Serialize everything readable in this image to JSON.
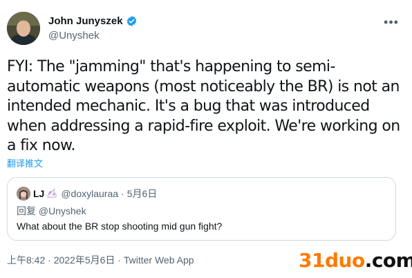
{
  "author": {
    "name": "John Junyszek",
    "handle": "@Unyshek"
  },
  "tweet": {
    "text": "FYI: The \"jamming\" that's happening to semi-\nautomatic weapons (most noticeably the BR) is not an\nintended mechanic. It's a bug that was introduced\nwhen addressing a rapid-fire exploit. We're working on\na fix now.",
    "translate_label": "翻译推文",
    "timestamp": "上午8:42 · 2022年5月6日 · Twitter Web App"
  },
  "quote": {
    "name": "LJ",
    "handle": "@doxylauraa",
    "separator": "·",
    "date": "5月6日",
    "reply_label": "回复 @Unyshek",
    "text": "What about the BR stop shooting mid gun fight?"
  },
  "menu": {
    "more_glyph": "•••"
  },
  "watermark": {
    "part_a": "31duo",
    "part_b": ".com"
  },
  "colors": {
    "accent": "#1d9bf0",
    "secondary_text": "#536471",
    "border": "#cfd9de",
    "watermark_orange": "#ff7a00"
  }
}
